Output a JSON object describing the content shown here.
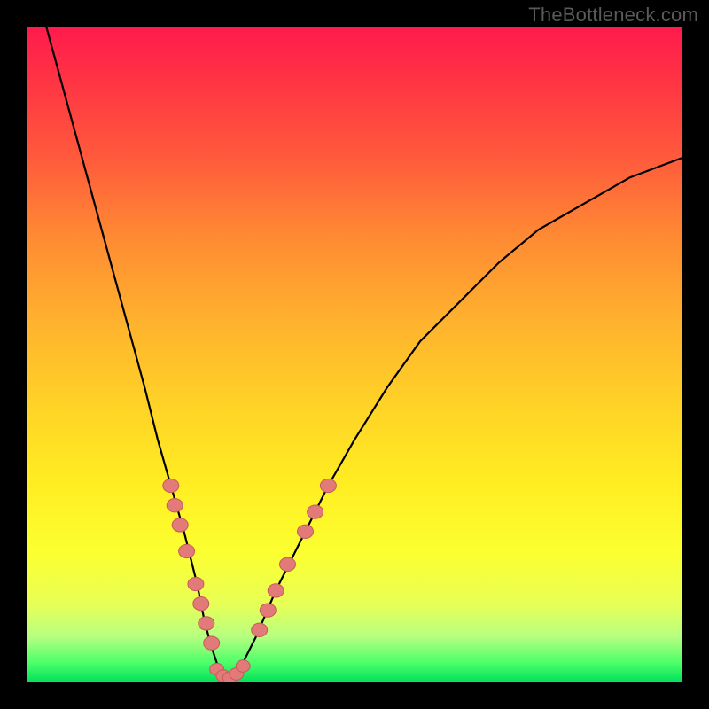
{
  "watermark": "TheBottleneck.com",
  "colors": {
    "frame": "#000000",
    "gradient_top": "#ff1a4d",
    "gradient_bottom": "#00e05a",
    "curve": "#000000",
    "marker_fill": "#e27a7a",
    "marker_stroke": "#c75a5a"
  },
  "chart_data": {
    "type": "line",
    "title": "",
    "xlabel": "",
    "ylabel": "",
    "xlim": [
      0,
      100
    ],
    "ylim": [
      0,
      100
    ],
    "grid": false,
    "legend": false,
    "series": [
      {
        "name": "bottleneck-curve",
        "x": [
          3,
          6,
          9,
          12,
          15,
          18,
          20,
          22,
          24,
          26,
          27,
          28,
          29,
          30,
          31,
          32,
          33,
          35,
          38,
          42,
          46,
          50,
          55,
          60,
          66,
          72,
          78,
          85,
          92,
          100
        ],
        "y": [
          100,
          89,
          78,
          67,
          56,
          45,
          37,
          30,
          23,
          15,
          10,
          6,
          3,
          1,
          0.5,
          1,
          3,
          7,
          14,
          22,
          30,
          37,
          45,
          52,
          58,
          64,
          69,
          73,
          77,
          80
        ]
      }
    ],
    "markers_left": [
      {
        "x": 22.0,
        "y": 30
      },
      {
        "x": 22.6,
        "y": 27
      },
      {
        "x": 23.4,
        "y": 24
      },
      {
        "x": 24.4,
        "y": 20
      },
      {
        "x": 25.8,
        "y": 15
      },
      {
        "x": 26.6,
        "y": 12
      },
      {
        "x": 27.4,
        "y": 9
      },
      {
        "x": 28.2,
        "y": 6
      }
    ],
    "markers_bottom": [
      {
        "x": 29.0,
        "y": 2.0
      },
      {
        "x": 30.0,
        "y": 1.0
      },
      {
        "x": 31.0,
        "y": 0.7
      },
      {
        "x": 32.0,
        "y": 1.3
      },
      {
        "x": 33.0,
        "y": 2.5
      }
    ],
    "markers_right": [
      {
        "x": 35.5,
        "y": 8
      },
      {
        "x": 36.8,
        "y": 11
      },
      {
        "x": 38.0,
        "y": 14
      },
      {
        "x": 39.8,
        "y": 18
      },
      {
        "x": 42.5,
        "y": 23
      },
      {
        "x": 44.0,
        "y": 26
      },
      {
        "x": 46.0,
        "y": 30
      }
    ]
  }
}
